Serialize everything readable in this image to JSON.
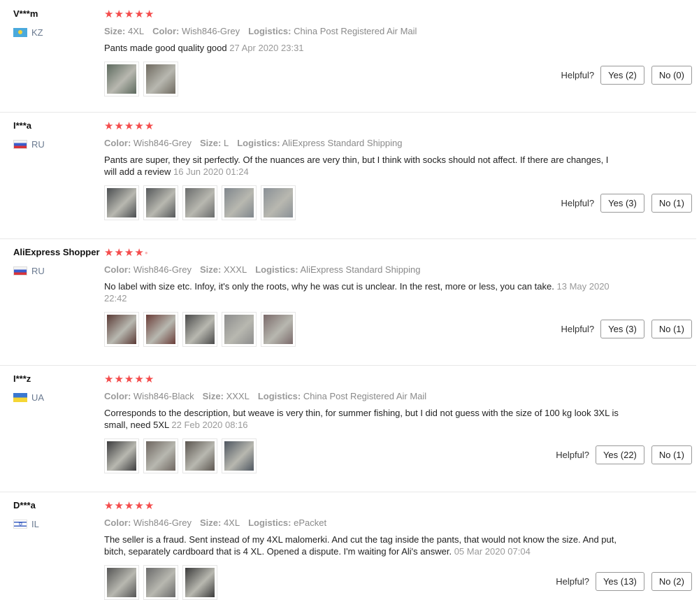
{
  "labels": {
    "helpful": "Helpful?",
    "size": "Size:",
    "color": "Color:",
    "logistics": "Logistics:"
  },
  "reviews": [
    {
      "user": "V***m",
      "country": "KZ",
      "flag": "flag-kz",
      "stars": 5,
      "size": "4XL",
      "color": "Wish846-Grey",
      "logistics": "China Post Registered Air Mail",
      "text": "Pants made good quality good",
      "date": "27 Apr 2020 23:31",
      "yes": "Yes (2)",
      "no": "No (0)",
      "photo_colors": [
        "#5d6a5e",
        "#6f6a60"
      ]
    },
    {
      "user": "I***a",
      "country": "RU",
      "flag": "flag-ru",
      "stars": 5,
      "color": "Wish846-Grey",
      "size": "L",
      "logistics": "AliExpress Standard Shipping",
      "text": "Pants are super, they sit perfectly. Of the nuances are very thin, but I think with socks should not affect. If there are changes, I will add a review",
      "date": "16 Jun 2020 01:24",
      "yes": "Yes (3)",
      "no": "No (1)",
      "photo_colors": [
        "#4a4d50",
        "#55585a",
        "#6a6c6c",
        "#7f868c",
        "#8a9096"
      ]
    },
    {
      "user": "AliExpress Shopper",
      "country": "RU",
      "flag": "flag-ru",
      "stars": 4,
      "color": "Wish846-Grey",
      "size": "XXXL",
      "logistics": "AliExpress Standard Shipping",
      "text": "No label with size etc. Infoy, it's only the roots, why he was cut is unclear. In the rest, more or less, you can take.",
      "date": "13 May 2020 22:42",
      "yes": "Yes (3)",
      "no": "No (1)",
      "photo_colors": [
        "#5a3a35",
        "#6a3d38",
        "#4a4a4a",
        "#8c8c8c",
        "#7a6a6a"
      ]
    },
    {
      "user": "I***z",
      "country": "UA",
      "flag": "flag-ua",
      "stars": 5,
      "color": "Wish846-Black",
      "size": "XXXL",
      "logistics": "China Post Registered Air Mail",
      "text": "Corresponds to the description, but weave is very thin, for summer fishing, but I did not guess with the size of 100 kg look 3XL is small, need 5XL",
      "date": "22 Feb 2020 08:16",
      "yes": "Yes (22)",
      "no": "No (1)",
      "photo_colors": [
        "#3c3c3e",
        "#6e6660",
        "#5c5650",
        "#4e5660"
      ]
    },
    {
      "user": "D***a",
      "country": "IL",
      "flag": "flag-il",
      "stars": 5,
      "color": "Wish846-Grey",
      "size": "4XL",
      "logistics": "ePacket",
      "text": "The seller is a fraud. Sent instead of my 4XL malomerki. And cut the tag inside the pants, that would not know the size. And put, bitch, separately cardboard that is 4 XL. Opened a dispute. I'm waiting for Ali's answer.",
      "date": "05 Mar 2020 07:04",
      "yes": "Yes (13)",
      "no": "No (2)",
      "photo_colors": [
        "#555555",
        "#6a6a6a",
        "#3a3a3a"
      ]
    }
  ]
}
